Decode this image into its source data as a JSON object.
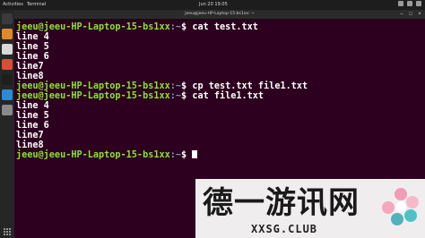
{
  "topbar": {
    "activities": "Activities",
    "app_menu": "Terminal",
    "clock": "Jun 20 19:05"
  },
  "window": {
    "title": "jeeu@jeeu-HP-Laptop-15-bs1xx: ~"
  },
  "terminal": {
    "prompt_user": "jeeu@jeeu-HP-Laptop-15-bs1xx",
    "prompt_path": ":~",
    "prompt_sym": "$ ",
    "lines": [
      {
        "kind": "prompt",
        "cmd": "cat test.txt"
      },
      {
        "kind": "out",
        "text": "line 4"
      },
      {
        "kind": "out",
        "text": "line 5"
      },
      {
        "kind": "out",
        "text": "line 6"
      },
      {
        "kind": "out",
        "text": "line7"
      },
      {
        "kind": "out",
        "text": "line8"
      },
      {
        "kind": "prompt",
        "cmd": "cp test.txt file1.txt"
      },
      {
        "kind": "prompt",
        "cmd": "cat file1.txt"
      },
      {
        "kind": "out",
        "text": "line 4"
      },
      {
        "kind": "out",
        "text": "line 5"
      },
      {
        "kind": "out",
        "text": "line 6"
      },
      {
        "kind": "out",
        "text": "line7"
      },
      {
        "kind": "out",
        "text": "line8"
      },
      {
        "kind": "prompt",
        "cmd": ""
      }
    ]
  },
  "dock": {
    "icons": [
      {
        "name": "terminal-app-icon",
        "color": "#3a3a3a"
      },
      {
        "name": "files-app-icon",
        "color": "#e0882c"
      },
      {
        "name": "text-editor-app-icon",
        "color": "#d9d9d9"
      },
      {
        "name": "chrome-app-icon",
        "color": "#dd4b39"
      },
      {
        "name": "pycharm-app-icon",
        "color": "#1e1e1e"
      },
      {
        "name": "vscode-app-icon",
        "color": "#2c8ad6"
      },
      {
        "name": "settings-app-icon",
        "color": "#8a8a8a"
      }
    ]
  },
  "watermark": {
    "cn_text": "德一游讯网",
    "en_text": "XXSG.CLUB"
  }
}
